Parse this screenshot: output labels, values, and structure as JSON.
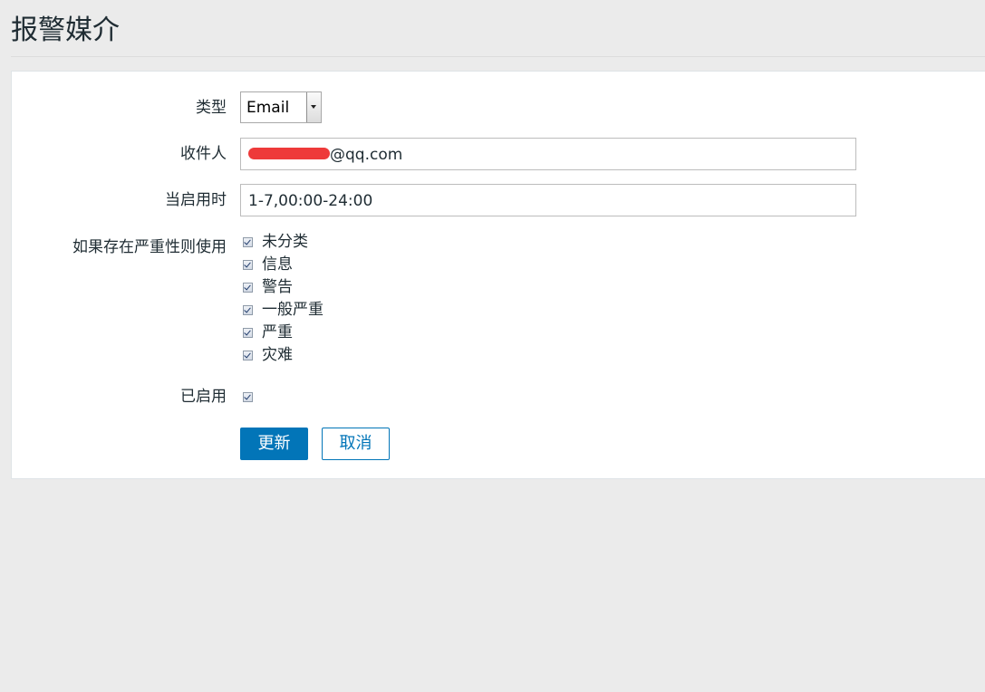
{
  "page": {
    "title": "报警媒介"
  },
  "form": {
    "type": {
      "label": "类型",
      "value": "Email"
    },
    "recipient": {
      "label": "收件人",
      "value_suffix": "@qq.com"
    },
    "when_active": {
      "label": "当启用时",
      "value": "1-7,00:00-24:00"
    },
    "severity": {
      "label": "如果存在严重性则使用",
      "options": [
        {
          "label": "未分类",
          "checked": true
        },
        {
          "label": "信息",
          "checked": true
        },
        {
          "label": "警告",
          "checked": true
        },
        {
          "label": "一般严重",
          "checked": true
        },
        {
          "label": "严重",
          "checked": true
        },
        {
          "label": "灾难",
          "checked": true
        }
      ]
    },
    "enabled": {
      "label": "已启用",
      "checked": true
    },
    "buttons": {
      "update": "更新",
      "cancel": "取消"
    }
  },
  "colors": {
    "primary": "#0275b8",
    "background": "#ebebeb",
    "panel": "#ffffff",
    "redaction": "#ee3a3a"
  }
}
